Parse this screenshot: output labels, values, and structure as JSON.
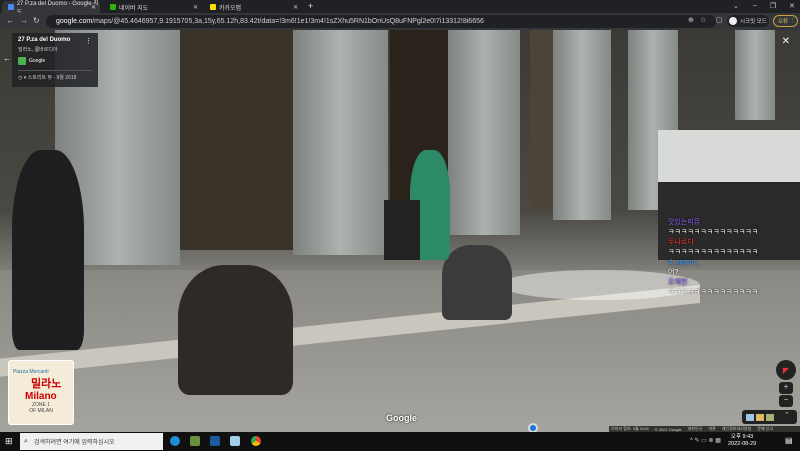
{
  "browser": {
    "tabs": [
      {
        "label": "27 P.za del Duomo - Google 지도",
        "active": true
      },
      {
        "label": "네이버 지도",
        "active": false
      },
      {
        "label": "카카오맵",
        "active": false
      }
    ],
    "url_host": "google.com",
    "url_path": "/maps/@45.4646957,9.1915705,3a,15y,65.12h,83.42t/data=!3m6!1e1!3m4!1sZXhu5RN1bOnUsQ8uFNPgl2e0!7i13312!8i6656",
    "profile_label": "시크릿 모드",
    "update_label": "오류"
  },
  "info_card": {
    "title": "27 P.za del Duomo",
    "subtitle": "밀라노, 롬바르디아",
    "source": "Google",
    "date": "스트리트 뷰 - 9월 2018"
  },
  "chat": [
    {
      "name": "맛있는미뮤",
      "msg": "ㅋㅋㅋㅋㅋㅋㅋㅋㅋㅋㅋㅋㅋㅋ",
      "color": "#8a5cf0"
    },
    {
      "name": "두나르다",
      "msg": "ㅋㅋㅋㅋㅋㅋㅋㅋㅋㅋㅋㅋㅋㅋ",
      "color": "#ff3030"
    },
    {
      "name": "d_argent_",
      "msg": "어?",
      "color": "#3aa0ff"
    },
    {
      "name": "오채현",
      "msg": "ㅋㅋㅋㅋㅋㅋㅋㅋㅋㅋㅋㅋㅋㅋ",
      "color": "#8a5cf0"
    }
  ],
  "minimap": {
    "place": "Piazza Mercanti",
    "city_ko": "밀라노",
    "city": "Milano",
    "zone": "ZONE 1",
    "zone2": "OF MILAN"
  },
  "google_logo": "Google",
  "footer": [
    "이미지 캡처: 9월 2018",
    "© 2022 Google",
    "대한민국",
    "약관",
    "개인정보처리방침",
    "문제 신고"
  ],
  "taskbar": {
    "search_placeholder": "검색하려면 여기에 입력하십시오",
    "time": "오후 9:43",
    "date": "2022-08-29"
  }
}
